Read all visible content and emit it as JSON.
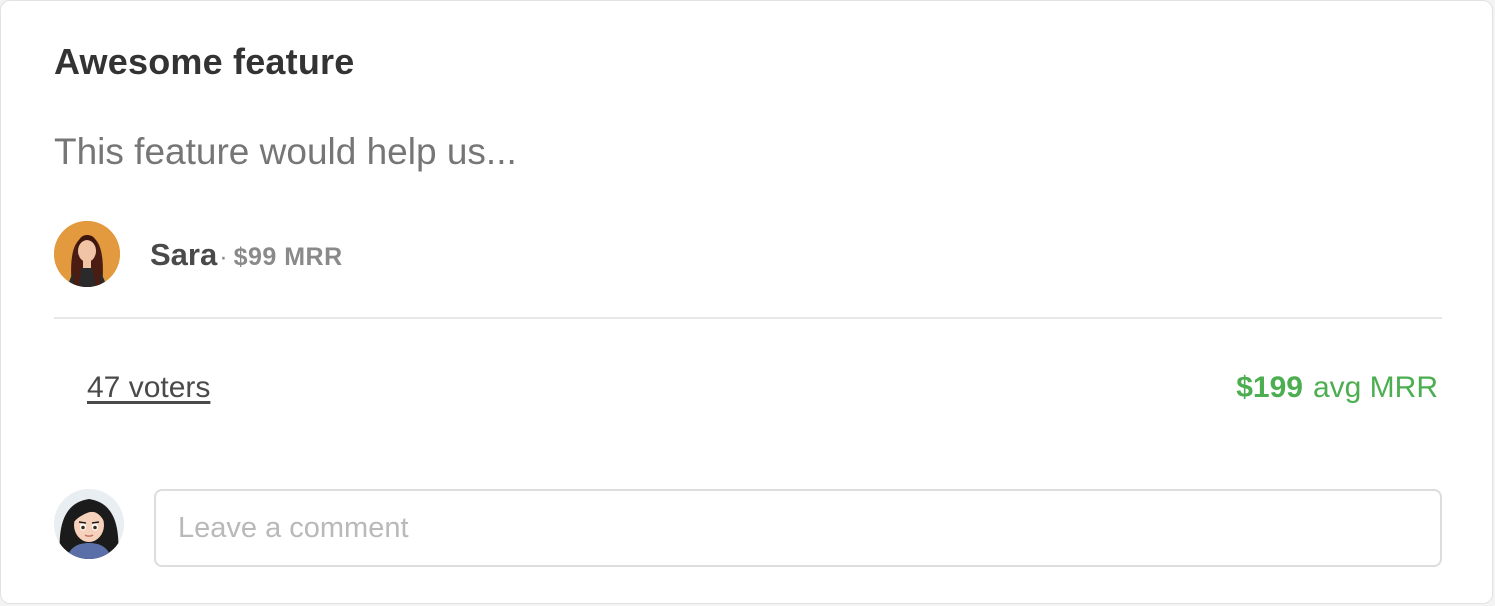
{
  "feature": {
    "title": "Awesome feature",
    "description": "This feature would help us..."
  },
  "author": {
    "name": "Sara",
    "separator": "·",
    "mrr": "$99 MRR",
    "avatar_icon": "woman-portrait-avatar"
  },
  "stats": {
    "voters_label": "47 voters",
    "avg_mrr_amount": "$199",
    "avg_mrr_label": "avg MRR"
  },
  "comment": {
    "placeholder": "Leave a comment",
    "value": "",
    "avatar_icon": "cartoon-user-avatar"
  },
  "colors": {
    "accent_green": "#4cae51",
    "author_avatar_bg": "#e39a3f"
  }
}
